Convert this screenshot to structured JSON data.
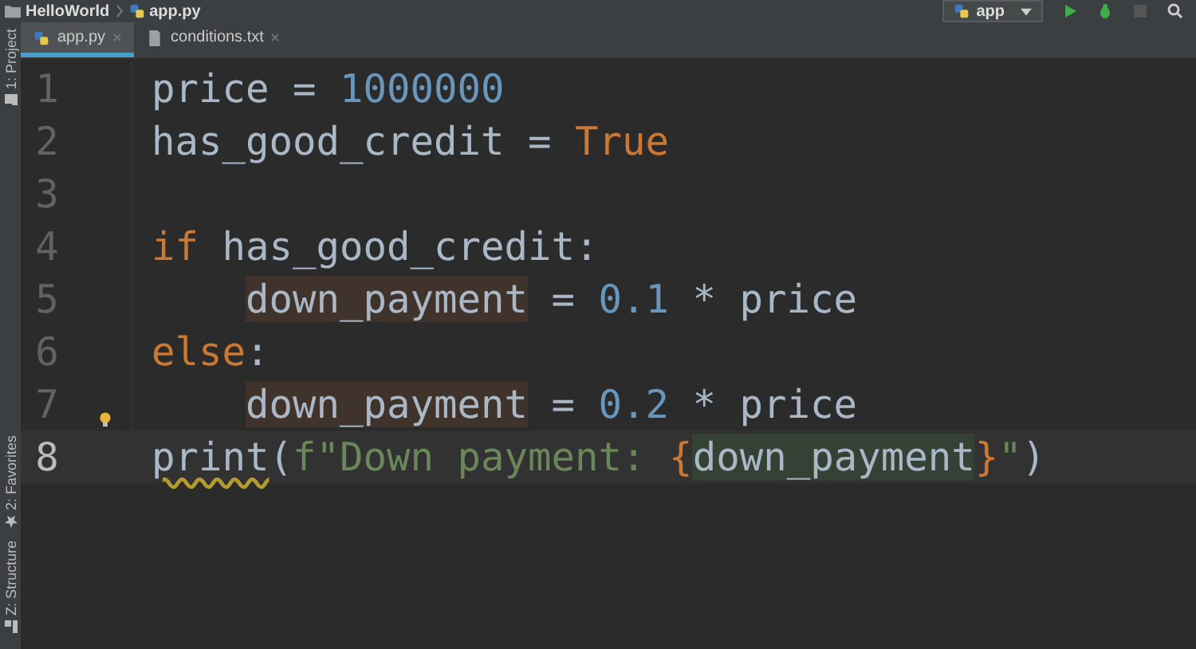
{
  "breadcrumb": [
    {
      "label": "HelloWorld",
      "kind": "folder"
    },
    {
      "label": "app.py",
      "kind": "python"
    }
  ],
  "run_config": {
    "label": "app"
  },
  "tool_windows": [
    {
      "label": "1: Project",
      "kind": "folder"
    },
    {
      "label": "2: Favorites",
      "kind": "star"
    },
    {
      "label": "Z: Structure",
      "kind": "structure"
    }
  ],
  "tabs": [
    {
      "label": "app.py",
      "kind": "python",
      "selected": true
    },
    {
      "label": "conditions.txt",
      "kind": "text",
      "selected": false
    }
  ],
  "editor": {
    "lines": [
      {
        "number": "1",
        "current": false,
        "bulb": false,
        "tokens": [
          {
            "kind": "plain",
            "text": "price = "
          },
          {
            "kind": "number",
            "text": "1000000"
          }
        ]
      },
      {
        "number": "2",
        "current": false,
        "bulb": false,
        "tokens": [
          {
            "kind": "plain",
            "text": "has_good_credit = "
          },
          {
            "kind": "keyword",
            "text": "True"
          }
        ]
      },
      {
        "number": "3",
        "current": false,
        "bulb": false
      },
      {
        "number": "4",
        "current": false,
        "bulb": false,
        "indented": false,
        "tokens": [
          {
            "kind": "keyword",
            "text": "if "
          },
          {
            "kind": "plain",
            "text": "has_good_credit:"
          }
        ]
      },
      {
        "number": "5",
        "current": false,
        "bulb": false,
        "indented": true,
        "tokens": [
          {
            "kind": "write",
            "text": "down_payment"
          },
          {
            "kind": "plain",
            "text": " = "
          },
          {
            "kind": "number",
            "text": "0.1"
          },
          {
            "kind": "plain",
            "text": " * price"
          }
        ]
      },
      {
        "number": "6",
        "current": false,
        "bulb": false,
        "tokens": [
          {
            "kind": "keyword",
            "text": "else"
          },
          {
            "kind": "plain",
            "text": ":"
          }
        ]
      },
      {
        "number": "7",
        "current": false,
        "bulb": true,
        "indented": true,
        "tokens": [
          {
            "kind": "write",
            "text": "down_payment"
          },
          {
            "kind": "plain",
            "text": " = "
          },
          {
            "kind": "number",
            "text": "0.2"
          },
          {
            "kind": "plain",
            "text": " * price"
          }
        ]
      },
      {
        "number": "8",
        "current": true,
        "bulb": false,
        "tokens": [
          {
            "kind": "warn",
            "text": "print"
          },
          {
            "kind": "plain",
            "text": "("
          },
          {
            "kind": "string",
            "text": "f\"Down payment: "
          },
          {
            "kind": "brace",
            "text": "{"
          },
          {
            "kind": "read",
            "text": "down_payment"
          },
          {
            "kind": "brace",
            "text": "}"
          },
          {
            "kind": "string",
            "text": "\""
          },
          {
            "kind": "plain",
            "text": ")"
          }
        ]
      }
    ]
  }
}
